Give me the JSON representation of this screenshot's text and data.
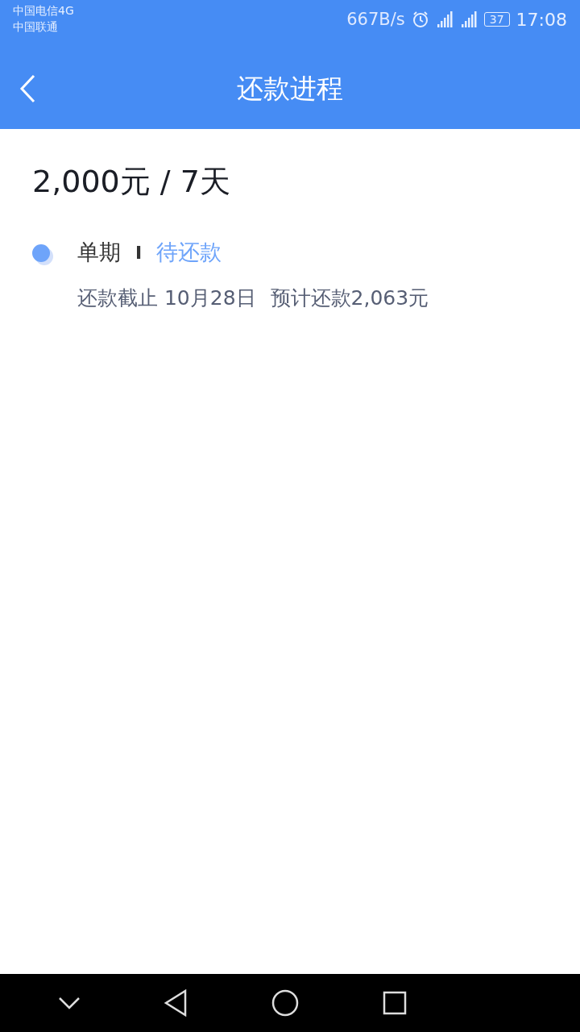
{
  "status_bar": {
    "carriers": [
      "中国电信4G",
      "中国联通"
    ],
    "speed": "667B/s",
    "battery": "37",
    "time": "17:08"
  },
  "header": {
    "title": "还款进程"
  },
  "loan": {
    "summary": "2,000元 / 7天"
  },
  "steps": [
    {
      "term": "单期",
      "separator": "I",
      "status": "待还款",
      "deadline": "还款截止 10月28日",
      "expected": "预计还款2,063元",
      "selected": true
    }
  ]
}
